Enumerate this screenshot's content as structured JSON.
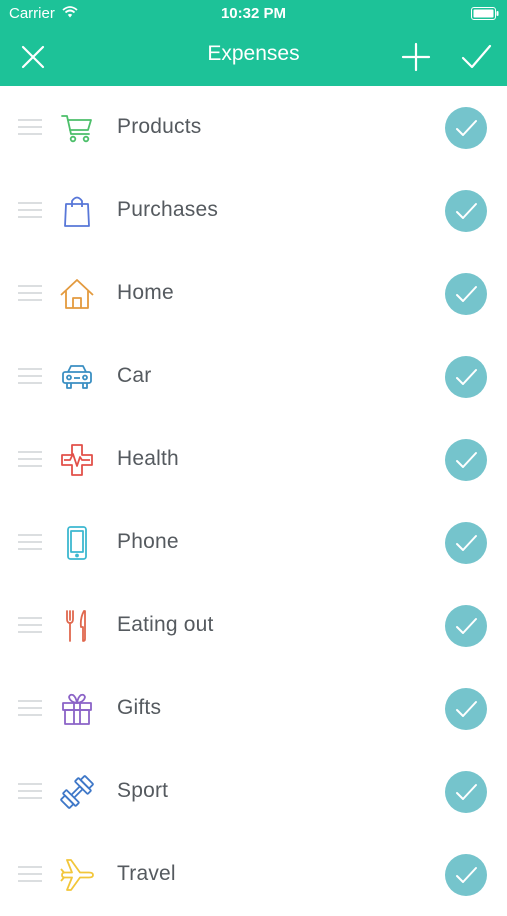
{
  "status_bar": {
    "carrier": "Carrier",
    "time": "10:32 PM"
  },
  "nav": {
    "title": "Expenses"
  },
  "colors": {
    "header": "#1dc298",
    "check_fill": "#75c4cc",
    "label_text": "#555a5f"
  },
  "categories": [
    {
      "label": "Products",
      "icon": "shopping-cart-icon",
      "color": "#4cbf6a"
    },
    {
      "label": "Purchases",
      "icon": "shopping-bag-icon",
      "color": "#5877d8"
    },
    {
      "label": "Home",
      "icon": "house-icon",
      "color": "#e39a3e"
    },
    {
      "label": "Car",
      "icon": "car-icon",
      "color": "#3b8fc2"
    },
    {
      "label": "Health",
      "icon": "medical-cross-icon",
      "color": "#e2514a"
    },
    {
      "label": "Phone",
      "icon": "phone-icon",
      "color": "#3db8d0"
    },
    {
      "label": "Eating out",
      "icon": "fork-knife-icon",
      "color": "#e0684e"
    },
    {
      "label": "Gifts",
      "icon": "gift-icon",
      "color": "#8b63c7"
    },
    {
      "label": "Sport",
      "icon": "dumbbell-icon",
      "color": "#3f78c8"
    },
    {
      "label": "Travel",
      "icon": "airplane-icon",
      "color": "#f2c63a"
    }
  ]
}
